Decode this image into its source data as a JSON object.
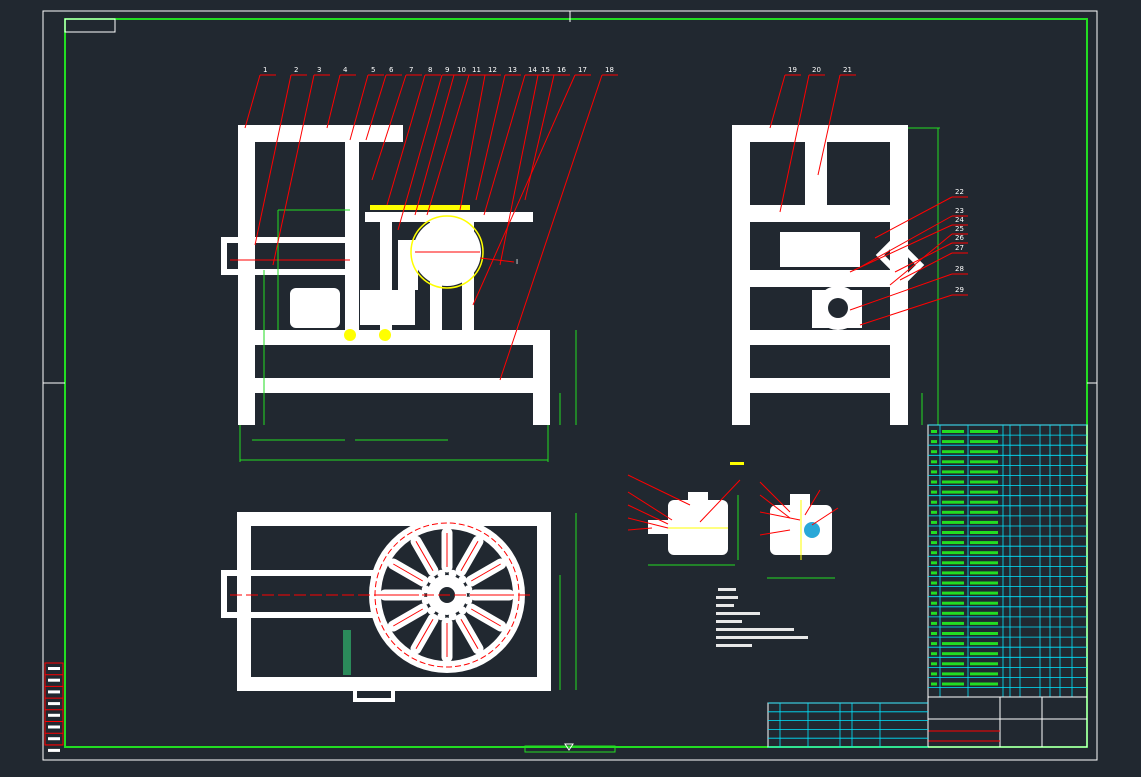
{
  "drawing": {
    "colors": {
      "background": "#212830",
      "frame": "#ffffff",
      "border": "#22dd22",
      "leader": "#ff0000",
      "table": "#00e5ff",
      "highlight": "#ffff00"
    },
    "front_view_part_labels": [
      "1",
      "2",
      "3",
      "4",
      "5",
      "6",
      "7",
      "8",
      "9",
      "10",
      "11",
      "12",
      "13",
      "14",
      "15",
      "16",
      "17",
      "18"
    ],
    "side_view_part_labels": [
      "19",
      "20",
      "21"
    ],
    "side_view_right_labels": [
      "22",
      "23",
      "24",
      "25",
      "26",
      "27",
      "28",
      "29"
    ],
    "detail_marker": "I"
  }
}
